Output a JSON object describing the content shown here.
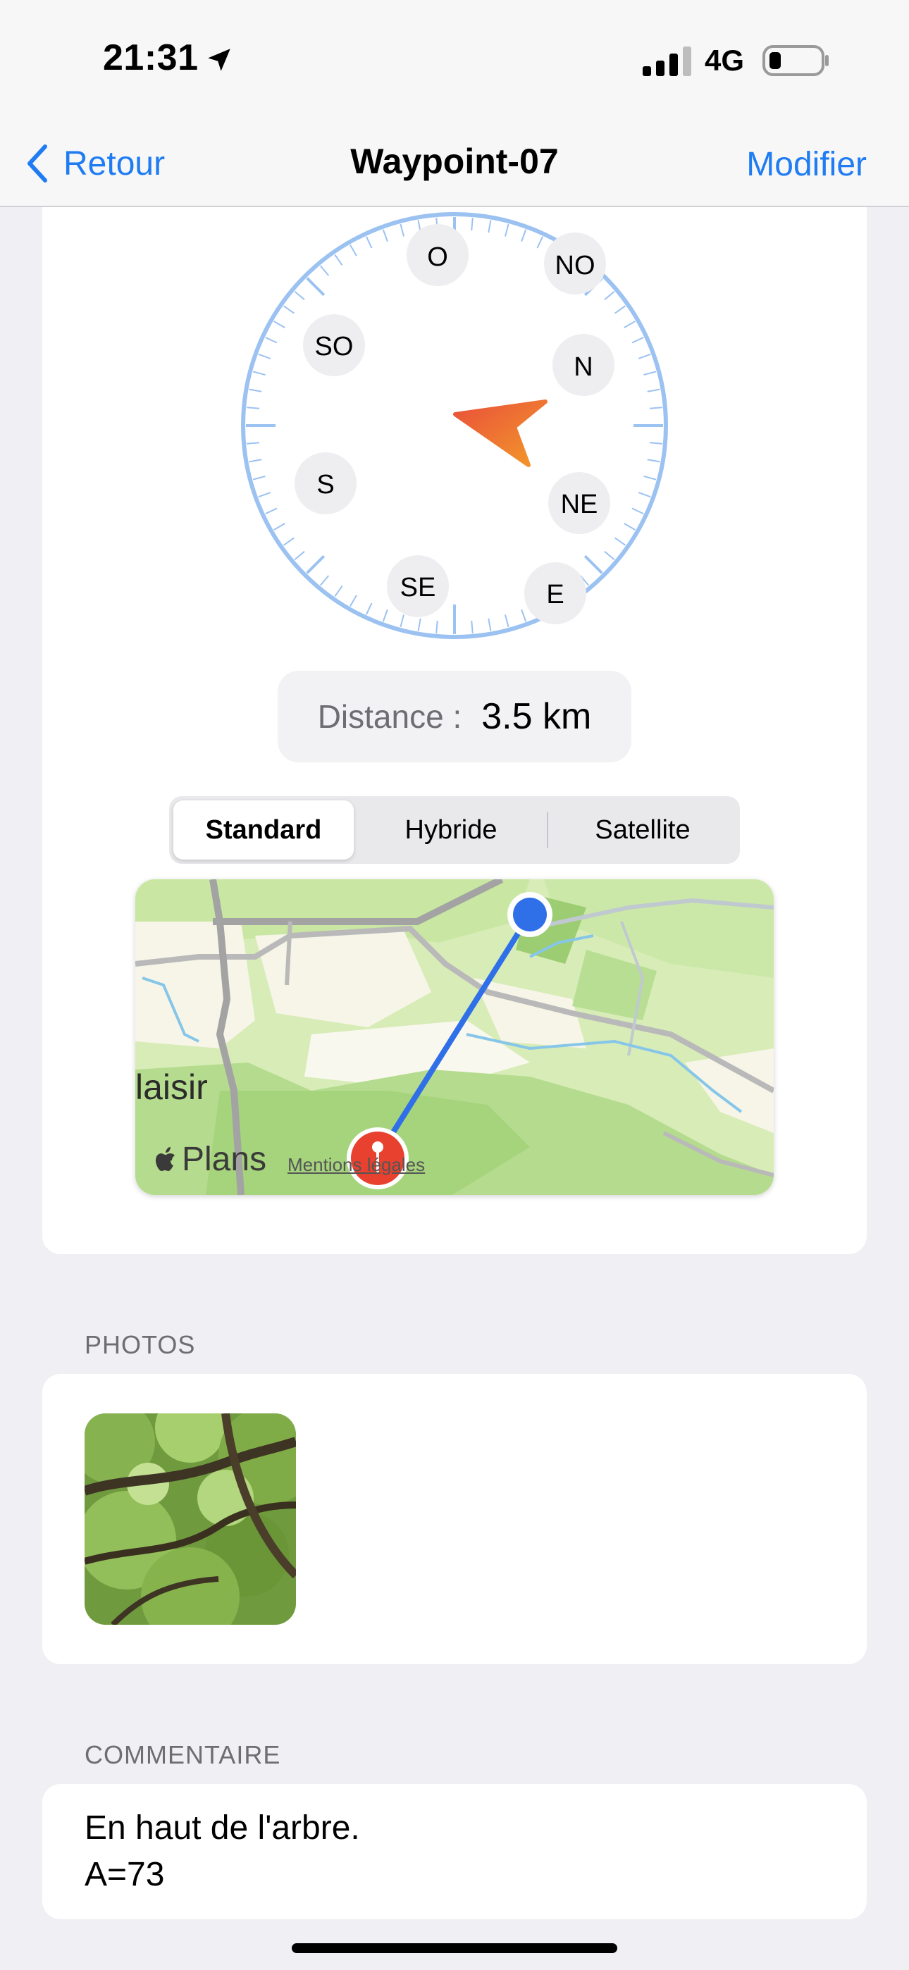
{
  "status_bar": {
    "time": "21:31",
    "network": "4G",
    "location_icon": "location-arrow-icon",
    "signal_icon": "cellular-signal-icon",
    "battery_icon": "battery-low-icon"
  },
  "nav": {
    "back_label": "Retour",
    "title": "Waypoint-07",
    "edit_label": "Modifier"
  },
  "compass": {
    "labels": {
      "o": "O",
      "no": "NO",
      "n": "N",
      "ne": "NE",
      "e": "E",
      "se": "SE",
      "s": "S",
      "so": "SO"
    },
    "needle_icon": "direction-arrow-icon",
    "colors": {
      "ring": "#9cc2f2",
      "needle_start": "#e9503a",
      "needle_end": "#f39a2a"
    }
  },
  "distance": {
    "label": "Distance :",
    "value": "3.5 km"
  },
  "map_type": {
    "options": [
      "Standard",
      "Hybride",
      "Satellite"
    ],
    "selected": "Standard"
  },
  "map": {
    "place_label": "laisir",
    "brand": "Plans",
    "legal": "Mentions légales",
    "colors": {
      "route": "#2f6fe8",
      "current_location": "#2f6fe8",
      "destination_pin": "#e8412f"
    }
  },
  "photos": {
    "section_title": "PHOTOS"
  },
  "comment": {
    "section_title": "COMMENTAIRE",
    "text": "En haut de l'arbre.\nA=73"
  },
  "colors": {
    "accent": "#1f7cf2",
    "background": "#efeff4"
  }
}
